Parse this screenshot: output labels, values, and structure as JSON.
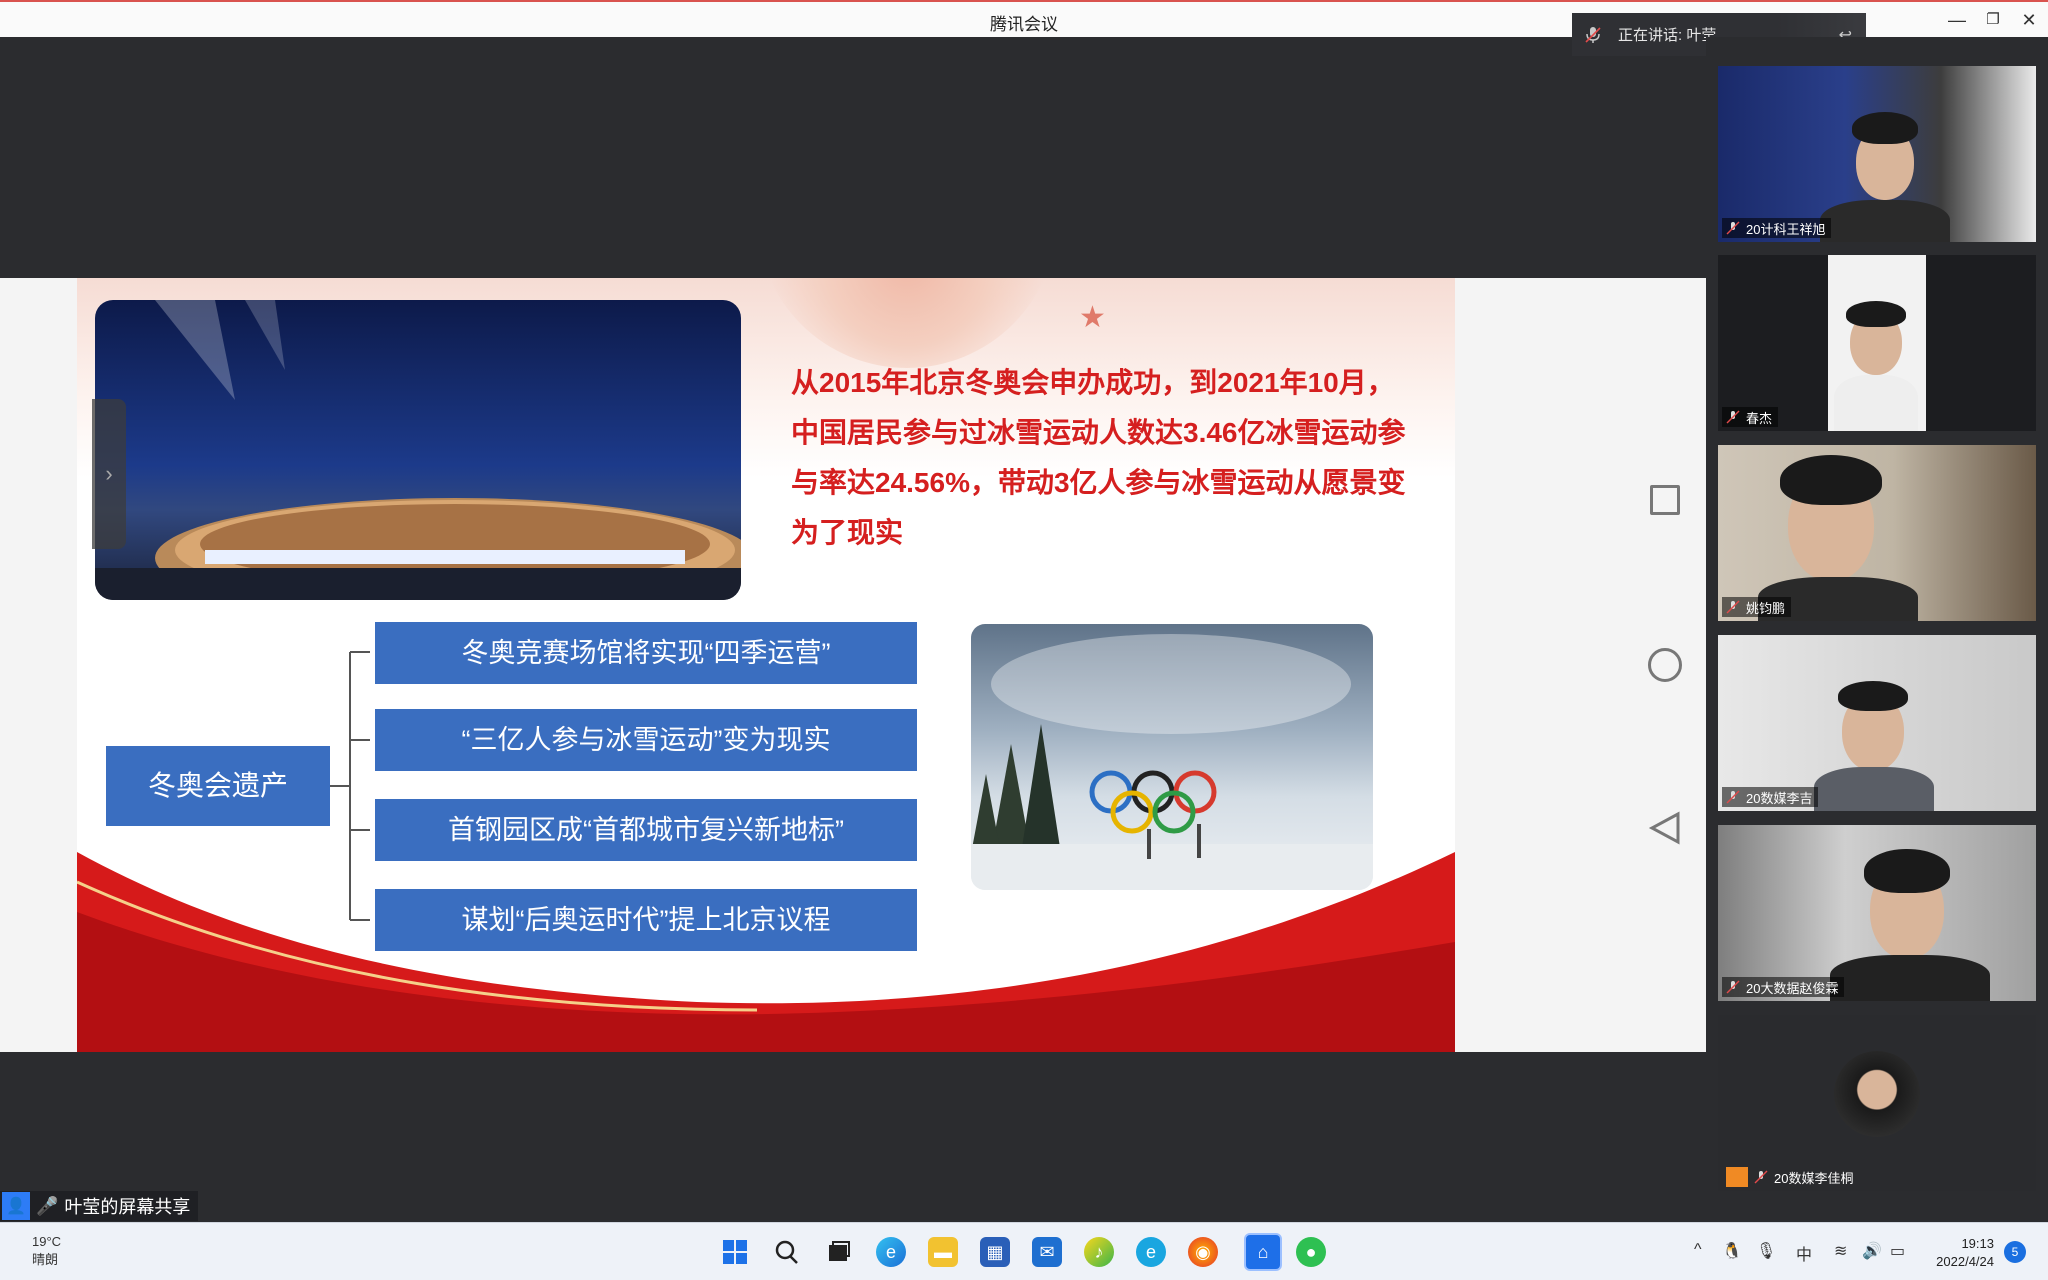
{
  "window": {
    "title": "腾讯会议"
  },
  "speaking": {
    "label": "正在讲话: 叶莹"
  },
  "share": {
    "owner_label": "叶莹的屏幕共享",
    "slide": {
      "headline": "从2015年北京冬奥会申办成功，到2021年10月，中国居民参与过冰雪运动人数达3.46亿冰雪运动参与率达24.56%，带动3亿人参与冰雪运动从愿景变为了现实",
      "legacy_title": "冬奥会遗产",
      "items": [
        "冬奥竞赛场馆将实现“四季运营”",
        "“三亿人参与冰雪运动”变为现实",
        "首钢园区成“首都城市复兴新地标”",
        "谋划“后奥运时代”提上北京议程"
      ]
    }
  },
  "participants": [
    {
      "name": "20计科王祥旭"
    },
    {
      "name": "春杰"
    },
    {
      "name": "姚钧鹏"
    },
    {
      "name": "20数媒李吉"
    },
    {
      "name": "20大数据赵俊霖"
    },
    {
      "name": "20数媒李佳桐"
    }
  ],
  "taskbar": {
    "weather_temp": "19°C",
    "weather_desc": "晴朗",
    "ime": "中",
    "time": "19:13",
    "date": "2022/4/24",
    "notification_count": "5"
  },
  "colors": {
    "accent": "#3a6ec0",
    "headline": "#d51f1f",
    "share_blue": "#2d7cf6"
  }
}
